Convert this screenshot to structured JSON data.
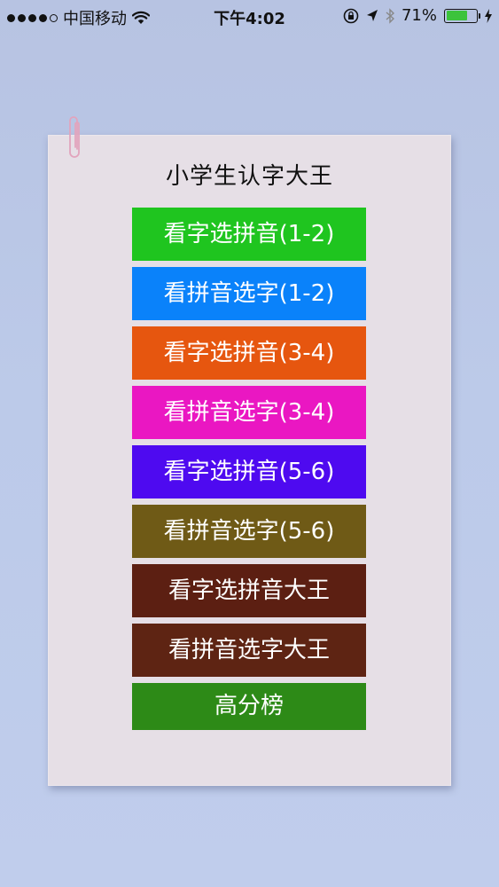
{
  "status_bar": {
    "carrier": "中国移动",
    "time": "下午4:02",
    "battery_percent": "71%",
    "battery_level": 0.71,
    "icons": [
      "signal-dots",
      "wifi-icon",
      "rotation-lock-icon",
      "location-icon",
      "bluetooth-icon",
      "battery-icon",
      "charging-icon"
    ]
  },
  "app": {
    "title": "小学生认字大王"
  },
  "menu": {
    "buttons": [
      {
        "label": "看字选拼音(1-2)",
        "color": "#1fc51f"
      },
      {
        "label": "看拼音选字(1-2)",
        "color": "#0a82fa"
      },
      {
        "label": "看字选拼音(3-4)",
        "color": "#e6560f"
      },
      {
        "label": "看拼音选字(3-4)",
        "color": "#ea17c2"
      },
      {
        "label": "看字选拼音(5-6)",
        "color": "#4e0af0"
      },
      {
        "label": "看拼音选字(5-6)",
        "color": "#6f5a16"
      },
      {
        "label": "看字选拼音大王",
        "color": "#5c1f12"
      },
      {
        "label": "看拼音选字大王",
        "color": "#5e2413"
      },
      {
        "label": "高分榜",
        "color": "#2d8a17"
      }
    ]
  }
}
